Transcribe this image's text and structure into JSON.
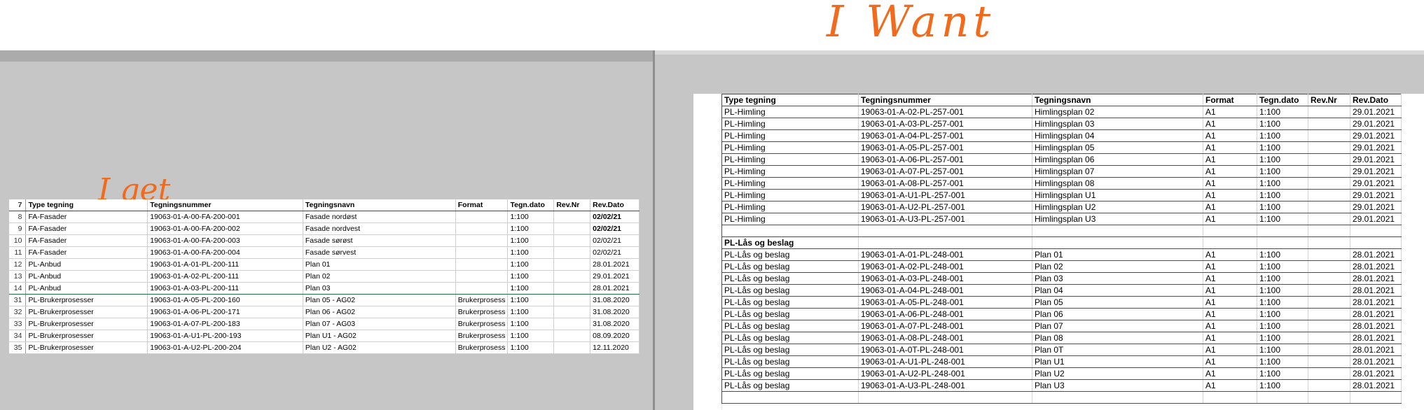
{
  "annotations": {
    "want": "I Want",
    "get": "I get"
  },
  "left": {
    "headers": [
      "Type tegning",
      "Tegningsnummer",
      "Tegningsnavn",
      "Format",
      "Tegn.dato",
      "Rev.Nr",
      "Rev.Dato"
    ],
    "header_row_num": "7",
    "rows": [
      {
        "n": "8",
        "type": "FA-Fasader",
        "num": "19063-01-A-00-FA-200-001",
        "name": "Fasade nordøst",
        "format": "",
        "tegn": "1:100",
        "rev": "",
        "revdato": "02/02/21"
      },
      {
        "n": "9",
        "type": "FA-Fasader",
        "num": "19063-01-A-00-FA-200-002",
        "name": "Fasade nordvest",
        "format": "",
        "tegn": "1:100",
        "rev": "",
        "revdato": "02/02/21"
      },
      {
        "n": "10",
        "type": "FA-Fasader",
        "num": "19063-01-A-00-FA-200-003",
        "name": "Fasade sørøst",
        "format": "",
        "tegn": "1:100",
        "rev": "",
        "revdato": "02/02/21"
      },
      {
        "n": "11",
        "type": "FA-Fasader",
        "num": "19063-01-A-00-FA-200-004",
        "name": "Fasade sørvest",
        "format": "",
        "tegn": "1:100",
        "rev": "",
        "revdato": "02/02/21"
      },
      {
        "n": "12",
        "type": "PL-Anbud",
        "num": "19063-01-A-01-PL-200-111",
        "name": "Plan 01",
        "format": "",
        "tegn": "1:100",
        "rev": "",
        "revdato": "28.01.2021"
      },
      {
        "n": "13",
        "type": "PL-Anbud",
        "num": "19063-01-A-02-PL-200-111",
        "name": "Plan 02",
        "format": "",
        "tegn": "1:100",
        "rev": "",
        "revdato": "29.01.2021"
      },
      {
        "n": "14",
        "type": "PL-Anbud",
        "num": "19063-01-A-03-PL-200-111",
        "name": "Plan 03",
        "format": "",
        "tegn": "1:100",
        "rev": "",
        "revdato": "28.01.2021"
      },
      {
        "n": "31",
        "type": "PL-Brukerprosesser",
        "num": "19063-01-A-05-PL-200-160",
        "name": "Plan 05 - AG02",
        "format": "Brukerprosess",
        "tegn": "1:100",
        "rev": "",
        "revdato": "31.08.2020"
      },
      {
        "n": "32",
        "type": "PL-Brukerprosesser",
        "num": "19063-01-A-06-PL-200-171",
        "name": "Plan 06 - AG02",
        "format": "Brukerprosess",
        "tegn": "1:100",
        "rev": "",
        "revdato": "31.08.2020"
      },
      {
        "n": "33",
        "type": "PL-Brukerprosesser",
        "num": "19063-01-A-07-PL-200-183",
        "name": "Plan 07 - AG03",
        "format": "Brukerprosess",
        "tegn": "1:100",
        "rev": "",
        "revdato": "31.08.2020"
      },
      {
        "n": "34",
        "type": "PL-Brukerprosesser",
        "num": "19063-01-A-U1-PL-200-193",
        "name": "Plan U1 - AG02",
        "format": "Brukerprosess",
        "tegn": "1:100",
        "rev": "",
        "revdato": "08.09.2020"
      },
      {
        "n": "35",
        "type": "PL-Brukerprosesser",
        "num": "19063-01-A-U2-PL-200-204",
        "name": "Plan U2 - AG02",
        "format": "Brukerprosess",
        "tegn": "1:100",
        "rev": "",
        "revdato": "12.11.2020"
      }
    ]
  },
  "right": {
    "headers": [
      "Type tegning",
      "Tegningsnummer",
      "Tegningsnavn",
      "Format",
      "Tegn.dato",
      "Rev.Nr",
      "Rev.Dato"
    ],
    "rows": [
      [
        "PL-Himling",
        "19063-01-A-02-PL-257-001",
        "Himlingsplan 02",
        "A1",
        "1:100",
        "",
        "29.01.2021"
      ],
      [
        "PL-Himling",
        "19063-01-A-03-PL-257-001",
        "Himlingsplan 03",
        "A1",
        "1:100",
        "",
        "29.01.2021"
      ],
      [
        "PL-Himling",
        "19063-01-A-04-PL-257-001",
        "Himlingsplan 04",
        "A1",
        "1:100",
        "",
        "29.01.2021"
      ],
      [
        "PL-Himling",
        "19063-01-A-05-PL-257-001",
        "Himlingsplan 05",
        "A1",
        "1:100",
        "",
        "29.01.2021"
      ],
      [
        "PL-Himling",
        "19063-01-A-06-PL-257-001",
        "Himlingsplan 06",
        "A1",
        "1:100",
        "",
        "29.01.2021"
      ],
      [
        "PL-Himling",
        "19063-01-A-07-PL-257-001",
        "Himlingsplan 07",
        "A1",
        "1:100",
        "",
        "29.01.2021"
      ],
      [
        "PL-Himling",
        "19063-01-A-08-PL-257-001",
        "Himlingsplan 08",
        "A1",
        "1:100",
        "",
        "29.01.2021"
      ],
      [
        "PL-Himling",
        "19063-01-A-U1-PL-257-001",
        "Himlingsplan U1",
        "A1",
        "1:100",
        "",
        "29.01.2021"
      ],
      [
        "PL-Himling",
        "19063-01-A-U2-PL-257-001",
        "Himlingsplan U2",
        "A1",
        "1:100",
        "",
        "29.01.2021"
      ],
      [
        "PL-Himling",
        "19063-01-A-U3-PL-257-001",
        "Himlingsplan U3",
        "A1",
        "1:100",
        "",
        "29.01.2021"
      ],
      [
        "",
        "",
        "",
        "",
        "",
        "",
        ""
      ],
      [
        "PL-Lås og beslag",
        "",
        "",
        "",
        "",
        "",
        ""
      ],
      [
        "PL-Lås og beslag",
        "19063-01-A-01-PL-248-001",
        "Plan 01",
        "A1",
        "1:100",
        "",
        "28.01.2021"
      ],
      [
        "PL-Lås og beslag",
        "19063-01-A-02-PL-248-001",
        "Plan 02",
        "A1",
        "1:100",
        "",
        "28.01.2021"
      ],
      [
        "PL-Lås og beslag",
        "19063-01-A-03-PL-248-001",
        "Plan 03",
        "A1",
        "1:100",
        "",
        "28.01.2021"
      ],
      [
        "PL-Lås og beslag",
        "19063-01-A-04-PL-248-001",
        "Plan 04",
        "A1",
        "1:100",
        "",
        "28.01.2021"
      ],
      [
        "PL-Lås og beslag",
        "19063-01-A-05-PL-248-001",
        "Plan 05",
        "A1",
        "1:100",
        "",
        "28.01.2021"
      ],
      [
        "PL-Lås og beslag",
        "19063-01-A-06-PL-248-001",
        "Plan 06",
        "A1",
        "1:100",
        "",
        "28.01.2021"
      ],
      [
        "PL-Lås og beslag",
        "19063-01-A-07-PL-248-001",
        "Plan 07",
        "A1",
        "1:100",
        "",
        "28.01.2021"
      ],
      [
        "PL-Lås og beslag",
        "19063-01-A-08-PL-248-001",
        "Plan 08",
        "A1",
        "1:100",
        "",
        "28.01.2021"
      ],
      [
        "PL-Lås og beslag",
        "19063-01-A-0T-PL-248-001",
        "Plan 0T",
        "A1",
        "1:100",
        "",
        "28.01.2021"
      ],
      [
        "PL-Lås og beslag",
        "19063-01-A-U1-PL-248-001",
        "Plan U1",
        "A1",
        "1:100",
        "",
        "28.01.2021"
      ],
      [
        "PL-Lås og beslag",
        "19063-01-A-U2-PL-248-001",
        "Plan U2",
        "A1",
        "1:100",
        "",
        "28.01.2021"
      ],
      [
        "PL-Lås og beslag",
        "19063-01-A-U3-PL-248-001",
        "Plan U3",
        "A1",
        "1:100",
        "",
        "28.01.2021"
      ],
      [
        "",
        "",
        "",
        "",
        "",
        "",
        ""
      ]
    ]
  }
}
